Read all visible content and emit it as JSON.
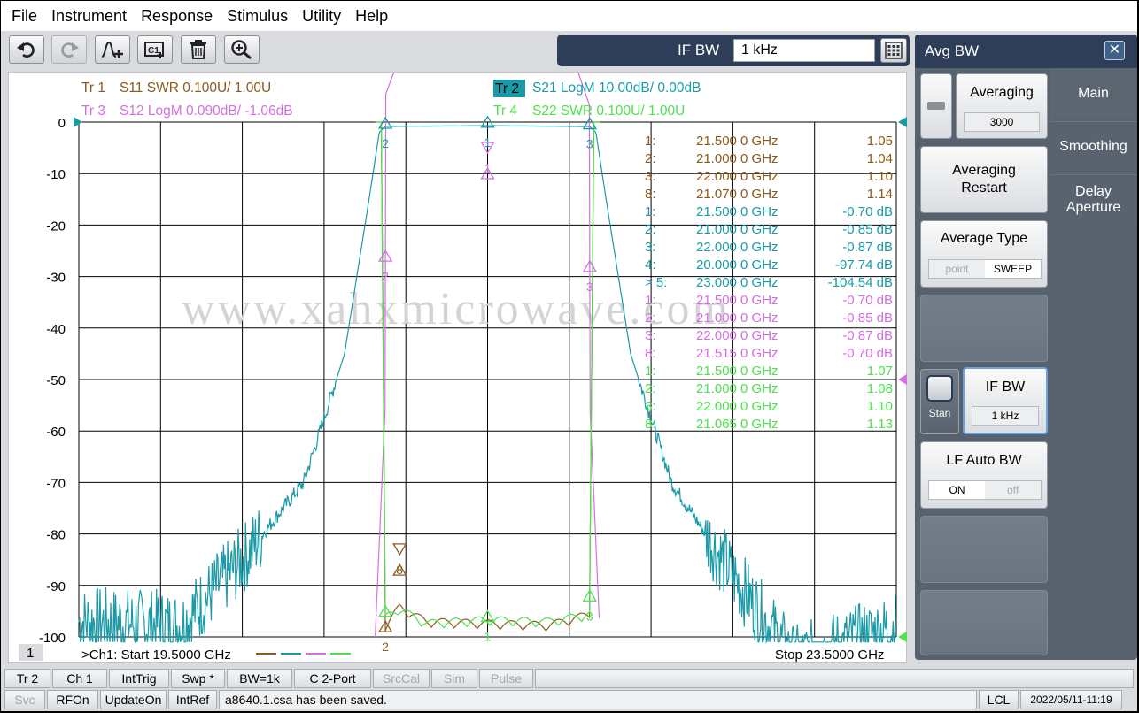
{
  "menu": [
    "File",
    "Instrument",
    "Response",
    "Stimulus",
    "Utility",
    "Help"
  ],
  "toolbar": {
    "buttons": [
      "undo-icon",
      "redo-icon",
      "add-marker-icon",
      "channel-icon",
      "delete-icon",
      "zoom-icon"
    ],
    "ifbw_label": "IF BW",
    "ifbw_value": "1 kHz"
  },
  "traces": {
    "tr1": {
      "name": "Tr  1",
      "text": "S11 SWR 0.100U/  1.00U",
      "color": "#8b5a1b"
    },
    "tr2": {
      "name": "Tr  2",
      "text": "S21 LogM 10.00dB/  0.00dB",
      "color": "#1a9aa6"
    },
    "tr3": {
      "name": "Tr  3",
      "text": "S12 LogM 0.090dB/  -1.06dB",
      "color": "#d36fe0"
    },
    "tr4": {
      "name": "Tr  4",
      "text": "S22 SWR 0.100U/  1.00U",
      "color": "#4ee04e"
    }
  },
  "y_ticks": [
    "0",
    "-10",
    "-20",
    "-30",
    "-40",
    "-50",
    "-60",
    "-70",
    "-80",
    "-90",
    "-100"
  ],
  "markers": [
    {
      "id": "1:",
      "freq": "21.500 0 GHz",
      "val": "1.05",
      "trace": "tr1"
    },
    {
      "id": "2:",
      "freq": "21.000 0 GHz",
      "val": "1.04",
      "trace": "tr1"
    },
    {
      "id": "3:",
      "freq": "22.000 0 GHz",
      "val": "1.10",
      "trace": "tr1"
    },
    {
      "id": "8:",
      "freq": "21.070 0 GHz",
      "val": "1.14",
      "trace": "tr1"
    },
    {
      "id": "1:",
      "freq": "21.500 0 GHz",
      "val": "-0.70 dB",
      "trace": "tr2"
    },
    {
      "id": "2:",
      "freq": "21.000 0 GHz",
      "val": "-0.85 dB",
      "trace": "tr2"
    },
    {
      "id": "3:",
      "freq": "22.000 0 GHz",
      "val": "-0.87 dB",
      "trace": "tr2"
    },
    {
      "id": "4:",
      "freq": "20.000 0 GHz",
      "val": "-97.74 dB",
      "trace": "tr2"
    },
    {
      "id": "> 5:",
      "freq": "23.000 0 GHz",
      "val": "-104.54 dB",
      "trace": "tr2"
    },
    {
      "id": "1:",
      "freq": "21.500 0 GHz",
      "val": "-0.70 dB",
      "trace": "tr3"
    },
    {
      "id": "2:",
      "freq": "21.000 0 GHz",
      "val": "-0.85 dB",
      "trace": "tr3"
    },
    {
      "id": "3:",
      "freq": "22.000 0 GHz",
      "val": "-0.87 dB",
      "trace": "tr3"
    },
    {
      "id": "8:",
      "freq": "21.515 0 GHz",
      "val": "-0.70 dB",
      "trace": "tr3"
    },
    {
      "id": "1:",
      "freq": "21.500 0 GHz",
      "val": "1.07",
      "trace": "tr4"
    },
    {
      "id": "2:",
      "freq": "21.000 0 GHz",
      "val": "1.08",
      "trace": "tr4"
    },
    {
      "id": "3:",
      "freq": "22.000 0 GHz",
      "val": "1.10",
      "trace": "tr4"
    },
    {
      "id": "8:",
      "freq": "21.065 0 GHz",
      "val": "1.13",
      "trace": "tr4"
    }
  ],
  "watermark": "www.xahxmicrowave.com",
  "channel_box": "1",
  "start_text": ">Ch1:  Start  19.5000 GHz",
  "stop_text": "Stop  23.5000 GHz",
  "chart_data": {
    "type": "line",
    "x_unit": "GHz",
    "xlim": [
      19.5,
      23.5
    ],
    "ylim": [
      -100,
      0
    ],
    "grid": true,
    "series": [
      {
        "name": "S21 LogM",
        "x": [
          19.5,
          20.0,
          20.3,
          20.6,
          20.8,
          20.92,
          20.97,
          21.0,
          21.5,
          22.0,
          22.03,
          22.08,
          22.2,
          22.4,
          22.7,
          23.0,
          23.5
        ],
        "y": [
          -97,
          -97.74,
          -85,
          -70,
          -45,
          -15,
          -2,
          -0.85,
          -0.7,
          -0.87,
          -2,
          -15,
          -45,
          -70,
          -88,
          -104.54,
          -98
        ]
      },
      {
        "name": "S12 LogM",
        "x": [
          20.95,
          21.0,
          21.1,
          21.3,
          21.5,
          21.7,
          21.9,
          22.0,
          22.05
        ],
        "y": [
          -95,
          -0.85,
          -0.82,
          -0.76,
          -0.7,
          -0.75,
          -0.83,
          -0.87,
          -95
        ]
      },
      {
        "name": "S11 SWR",
        "x": [
          21.0,
          21.07,
          21.2,
          21.5,
          21.8,
          22.0
        ],
        "y": [
          1.04,
          1.14,
          1.06,
          1.05,
          1.04,
          1.1
        ]
      },
      {
        "name": "S22 SWR",
        "x": [
          21.0,
          21.065,
          21.2,
          21.5,
          21.8,
          22.0
        ],
        "y": [
          1.08,
          1.13,
          1.05,
          1.07,
          1.06,
          1.1
        ]
      }
    ]
  },
  "panel": {
    "title": "Avg BW",
    "tabs": [
      "Main",
      "Smoothing",
      "Delay Aperture"
    ],
    "averaging_label": "Averaging",
    "averaging_value": "3000",
    "avg_restart": "Averaging Restart",
    "avg_type_label": "Average Type",
    "avg_type_opts": [
      "point",
      "SWEEP"
    ],
    "stan_label": "Stan",
    "ifbw_label": "IF BW",
    "ifbw_value": "1 kHz",
    "lf_label": "LF Auto BW",
    "lf_opts": [
      "ON",
      "off"
    ]
  },
  "status1": [
    "Tr 2",
    "Ch 1",
    "IntTrig",
    "Swp *",
    "BW=1k",
    "C  2-Port",
    "SrcCal",
    "Sim",
    "Pulse"
  ],
  "status2": [
    "Svc",
    "RFOn",
    "UpdateOn",
    "IntRef"
  ],
  "status_message": "a8640.1.csa has been saved.",
  "status_lcl": "LCL",
  "status_time": "2022/05/11-11:19"
}
